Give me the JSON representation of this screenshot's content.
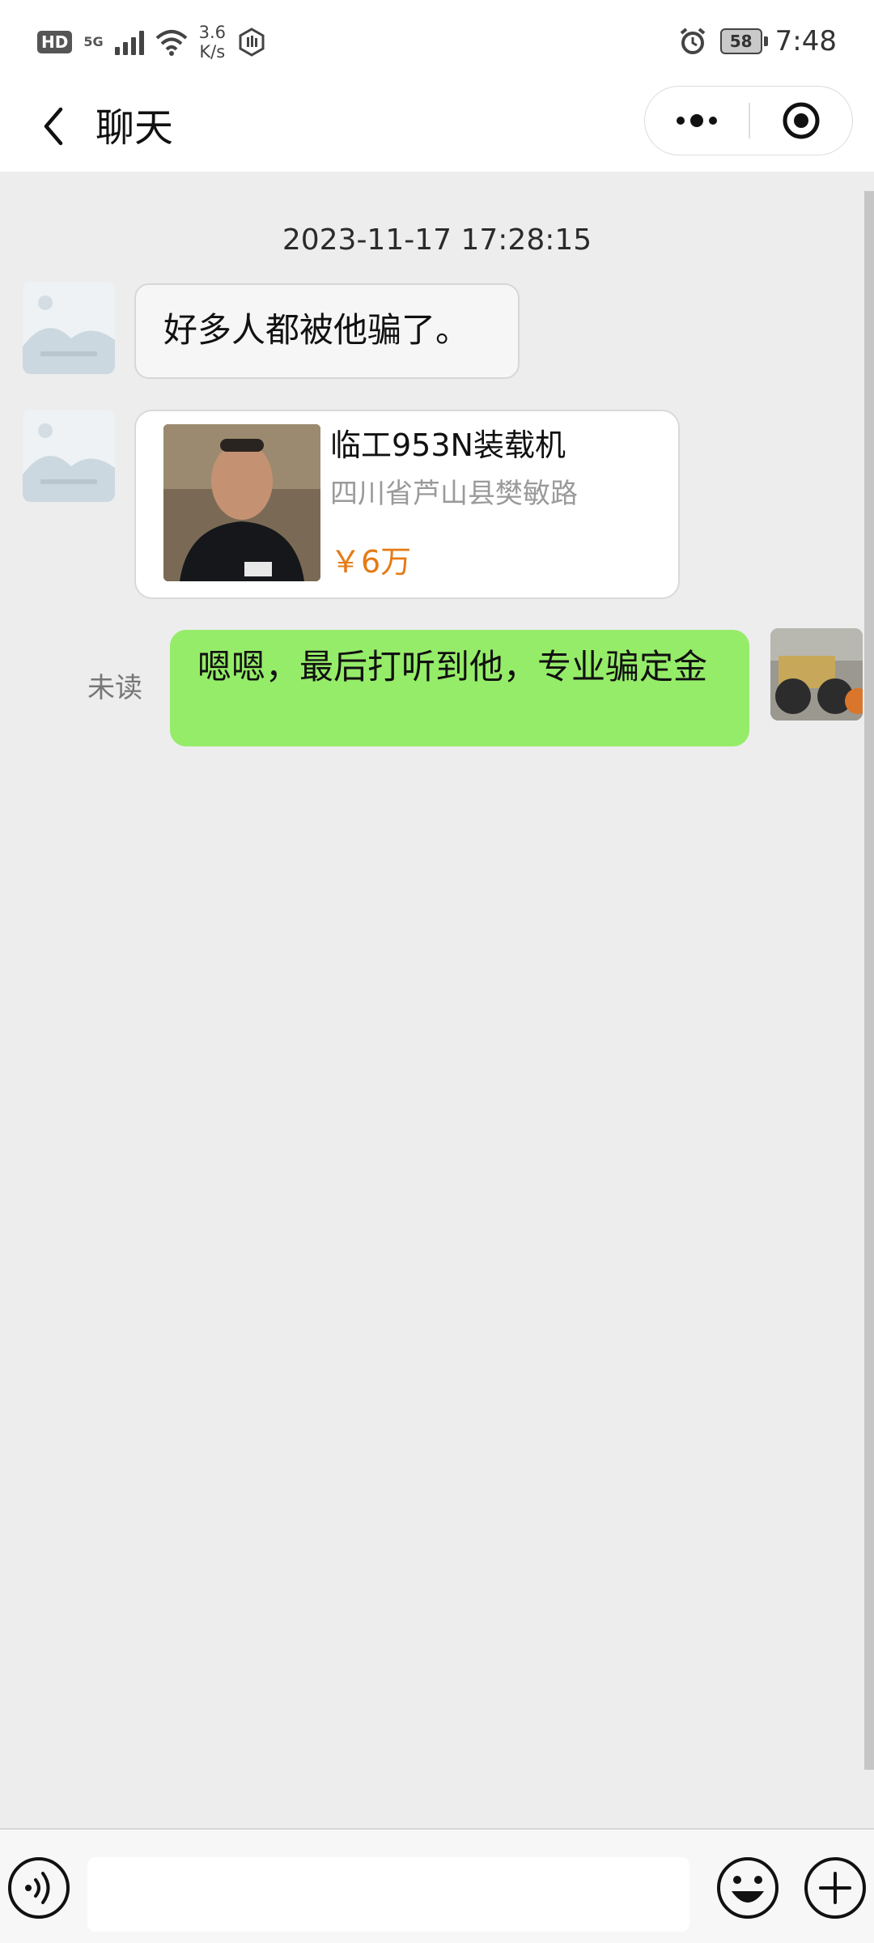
{
  "status_bar": {
    "hd": "HD",
    "network": "5G",
    "speed_value": "3.6",
    "speed_unit": "K/s",
    "battery": "58",
    "time": "7:48",
    "icons": [
      "hd-icon",
      "signal-icon",
      "wifi-icon",
      "shield-icon",
      "alarm-icon",
      "battery-icon"
    ]
  },
  "nav": {
    "title": "聊天",
    "back_icon": "chevron-left-icon",
    "more_icon": "more-dots-icon",
    "close_icon": "target-close-icon"
  },
  "chat": {
    "timestamp": "2023-11-17 17:28:15",
    "messages": [
      {
        "side": "left",
        "text": "好多人都被他骗了。"
      },
      {
        "side": "left",
        "type": "product-card",
        "title": "临工953N装载机",
        "address": "四川省芦山县樊敏路",
        "price": "￥6万"
      },
      {
        "side": "right",
        "status": "未读",
        "text": "嗯嗯，最后打听到他，专业骗定金"
      }
    ]
  },
  "input_bar": {
    "placeholder": "",
    "icons": [
      "voice-icon",
      "emoji-icon",
      "plus-icon"
    ]
  },
  "colors": {
    "self_bubble": "#95ec69",
    "price": "#e57b14",
    "background": "#ededed"
  }
}
